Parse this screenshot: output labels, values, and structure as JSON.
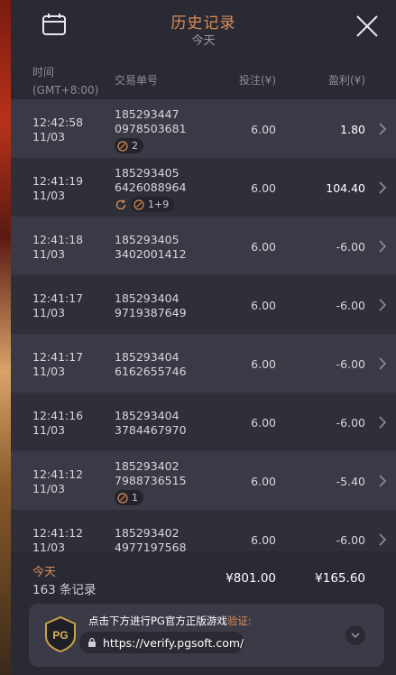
{
  "header": {
    "title": "历史记录",
    "subtitle": "今天"
  },
  "columns": {
    "time_line1": "时间",
    "time_line2": "(GMT+8:00)",
    "order": "交易单号",
    "bet": "投注(¥)",
    "profit": "盈利(¥)"
  },
  "rows": [
    {
      "time": "12:42:58",
      "date": "11/03",
      "id1": "185293447",
      "id2": "0978503681",
      "bet": "6.00",
      "profit": "1.80",
      "badge": "2",
      "profit_positive": true
    },
    {
      "time": "12:41:19",
      "date": "11/03",
      "id1": "185293405",
      "id2": "6426088964",
      "bet": "6.00",
      "profit": "104.40",
      "badge": "1+9",
      "profit_positive": true
    },
    {
      "time": "12:41:18",
      "date": "11/03",
      "id1": "185293405",
      "id2": "3402001412",
      "bet": "6.00",
      "profit": "-6.00"
    },
    {
      "time": "12:41:17",
      "date": "11/03",
      "id1": "185293404",
      "id2": "9719387649",
      "bet": "6.00",
      "profit": "-6.00"
    },
    {
      "time": "12:41:17",
      "date": "11/03",
      "id1": "185293404",
      "id2": "6162655746",
      "bet": "6.00",
      "profit": "-6.00"
    },
    {
      "time": "12:41:16",
      "date": "11/03",
      "id1": "185293404",
      "id2": "3784467970",
      "bet": "6.00",
      "profit": "-6.00"
    },
    {
      "time": "12:41:12",
      "date": "11/03",
      "id1": "185293402",
      "id2": "7988736515",
      "bet": "6.00",
      "profit": "-5.40",
      "badge": "1"
    },
    {
      "time": "12:41:12",
      "date": "11/03",
      "id1": "185293402",
      "id2": "4977197568",
      "bet": "6.00",
      "profit": "-6.00"
    }
  ],
  "footer": {
    "label": "今天",
    "count": "163 条记录",
    "total_bet": "¥801.00",
    "total_profit": "¥165.60"
  },
  "verify": {
    "text_main": "点击下方进行PG官方正版游戏",
    "text_accent": "验证:",
    "url": "https://verify.pgsoft.com/",
    "logo_text": "PG"
  },
  "colors": {
    "accent": "#d98d55",
    "panel": "#2e2e39",
    "row_light": "#3a3a46",
    "row_dark": "#2f2f3a"
  }
}
